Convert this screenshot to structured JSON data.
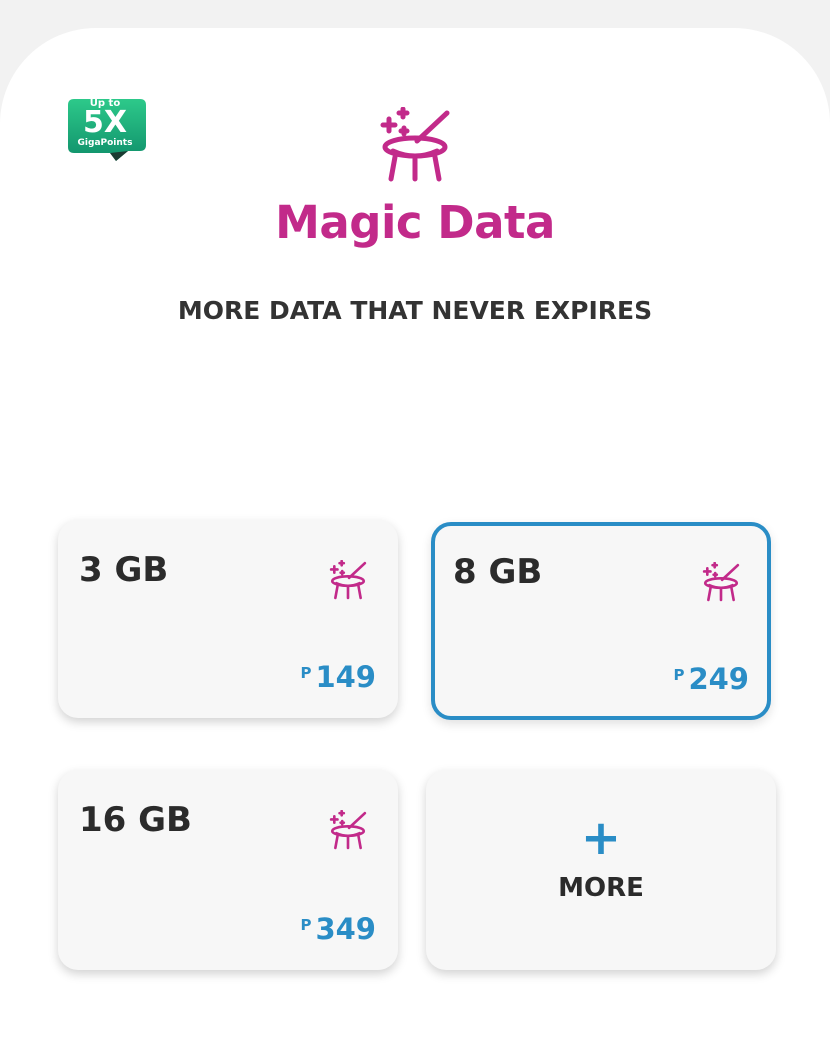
{
  "badge": {
    "top": "Up to",
    "main": "5X",
    "sub": "GigaPoints",
    "icon": "gigapoints-badge"
  },
  "brand": {
    "title": "Magic Data",
    "subtitle": "MORE DATA THAT NEVER EXPIRES",
    "icon": "magic-hat-wand-icon",
    "color": "#c22a8a"
  },
  "plans": [
    {
      "size": "3 GB",
      "currency": "P",
      "price": "149",
      "selected": false
    },
    {
      "size": "8 GB",
      "currency": "P",
      "price": "249",
      "selected": true
    },
    {
      "size": "16 GB",
      "currency": "P",
      "price": "349",
      "selected": false
    }
  ],
  "more": {
    "plus": "+",
    "label": "MORE"
  },
  "colors": {
    "accent": "#2a8dc6",
    "badge_green": "#1aa86a"
  }
}
